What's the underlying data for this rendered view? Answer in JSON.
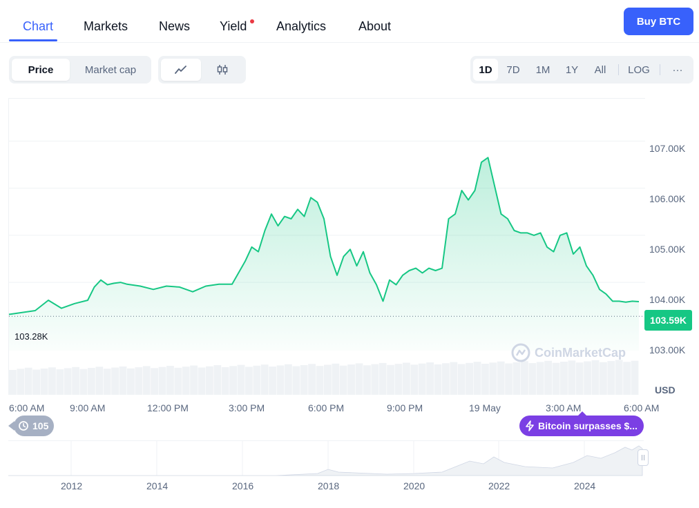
{
  "nav": {
    "tabs": [
      {
        "label": "Chart",
        "active": true
      },
      {
        "label": "Markets",
        "active": false
      },
      {
        "label": "News",
        "active": false
      },
      {
        "label": "Yield",
        "active": false,
        "badge": true
      },
      {
        "label": "Analytics",
        "active": false
      },
      {
        "label": "About",
        "active": false
      }
    ],
    "buy_label": "Buy BTC"
  },
  "controls": {
    "metric": {
      "price": "Price",
      "market_cap": "Market cap",
      "selected": "Price"
    },
    "chart_style": {
      "icons": [
        "line-chart-icon",
        "candlestick-icon"
      ],
      "selected": "line-chart-icon"
    },
    "ranges": [
      "1D",
      "7D",
      "1M",
      "1Y",
      "All"
    ],
    "selected_range": "1D",
    "log_label": "LOG",
    "more_label": "···"
  },
  "chart_data": {
    "type": "area",
    "currency_label": "USD",
    "y_ticks": [
      "107.00K",
      "106.00K",
      "105.00K",
      "104.00K",
      "103.00K"
    ],
    "ylim": [
      102.55,
      107.9
    ],
    "x_ticks": [
      "6:00 AM",
      "9:00 AM",
      "12:00 PM",
      "3:00 PM",
      "6:00 PM",
      "9:00 PM",
      "19 May",
      "3:00 AM",
      "6:00 AM"
    ],
    "open_price_label": "103.28K",
    "open_price": 103.28,
    "current_price_label": "103.59K",
    "x_hours": [
      0,
      0.5,
      1,
      1.5,
      2,
      2.5,
      3,
      3.25,
      3.5,
      3.75,
      4,
      4.25,
      4.5,
      5,
      5.5,
      6,
      6.5,
      7,
      7.5,
      8,
      8.5,
      9,
      9.25,
      9.5,
      9.75,
      10,
      10.25,
      10.5,
      10.75,
      11,
      11.25,
      11.5,
      11.75,
      12,
      12.25,
      12.5,
      12.75,
      13,
      13.25,
      13.5,
      13.75,
      14,
      14.25,
      14.5,
      14.75,
      15,
      15.25,
      15.5,
      15.75,
      16,
      16.25,
      16.5,
      16.75,
      17,
      17.25,
      17.5,
      17.75,
      18,
      18.25,
      18.5,
      18.75,
      19,
      19.25,
      19.5,
      19.75,
      20,
      20.25,
      20.5,
      20.75,
      21,
      21.25,
      21.5,
      21.75,
      22,
      22.25,
      22.5,
      22.75,
      23,
      23.25,
      23.5,
      23.75,
      24
    ],
    "prices": [
      103.32,
      103.36,
      103.4,
      103.62,
      103.45,
      103.55,
      103.62,
      103.9,
      104.05,
      103.95,
      103.98,
      104.0,
      103.96,
      103.92,
      103.85,
      103.92,
      103.9,
      103.8,
      103.92,
      103.96,
      103.96,
      104.45,
      104.75,
      104.65,
      105.1,
      105.45,
      105.2,
      105.4,
      105.35,
      105.55,
      105.4,
      105.8,
      105.7,
      105.35,
      104.55,
      104.15,
      104.55,
      104.7,
      104.35,
      104.65,
      104.2,
      103.95,
      103.6,
      104.05,
      103.95,
      104.15,
      104.25,
      104.3,
      104.2,
      104.3,
      104.25,
      104.3,
      105.35,
      105.45,
      105.95,
      105.75,
      105.95,
      106.55,
      106.65,
      106.05,
      105.45,
      105.35,
      105.1,
      105.05,
      105.05,
      105.0,
      105.05,
      104.75,
      104.65,
      105.0,
      105.05,
      104.6,
      104.75,
      104.35,
      104.15,
      103.85,
      103.75,
      103.6,
      103.6,
      103.58,
      103.6,
      103.59
    ],
    "volume_bars": 80,
    "overview_years": [
      "2012",
      "2014",
      "2016",
      "2018",
      "2020",
      "2022",
      "2024"
    ]
  },
  "watermark": "CoinMarketCap",
  "history": {
    "count": "105"
  },
  "news": {
    "label": "Bitcoin surpasses $..."
  },
  "colors": {
    "accent": "#3861fb",
    "up": "#16c784",
    "muted": "#58667e",
    "news": "#7b3fe4"
  }
}
